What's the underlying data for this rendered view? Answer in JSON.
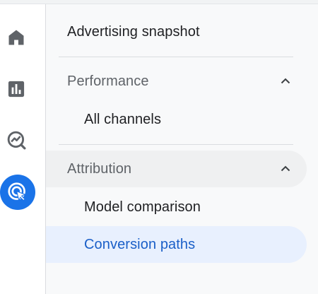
{
  "rail": {
    "items": [
      {
        "icon": "home-icon",
        "active": false
      },
      {
        "icon": "reports-icon",
        "active": false
      },
      {
        "icon": "explore-icon",
        "active": false
      },
      {
        "icon": "advertising-icon",
        "active": true
      }
    ],
    "active_color": "#1a73e8"
  },
  "nav": {
    "snapshot_label": "Advertising snapshot",
    "performance": {
      "label": "Performance",
      "expanded": true,
      "items": [
        "All channels"
      ]
    },
    "attribution": {
      "label": "Attribution",
      "expanded": true,
      "items": [
        "Model comparison",
        "Conversion paths"
      ]
    },
    "selected_item": "Conversion paths"
  },
  "colors": {
    "selected_bg": "#e8f0fe",
    "selected_text": "#1a5fc8",
    "panel_bg": "#f8f9fa"
  }
}
